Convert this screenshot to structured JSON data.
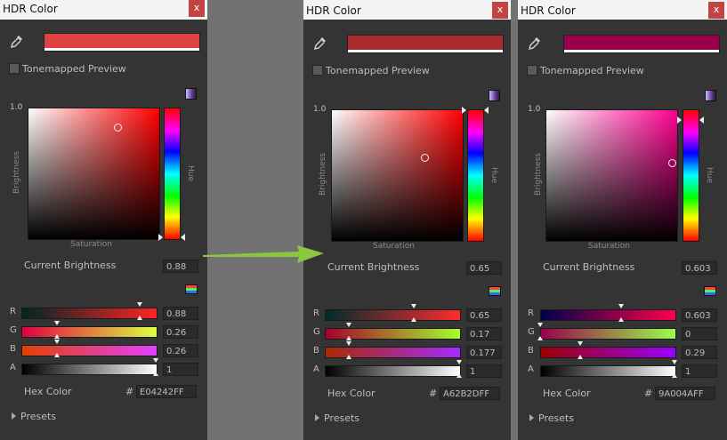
{
  "panels": [
    {
      "title": "HDR Color",
      "close": "x",
      "swatch_color": "#e04242",
      "tonemapped_label": "Tonemapped Preview",
      "one_label": "1.0",
      "brightness_axis": "Brightness",
      "hue_axis": "Hue",
      "saturation_axis": "Saturation",
      "hue_color": "#ff0000",
      "current_brightness_label": "Current Brightness",
      "current_brightness": "0.88",
      "channels": [
        {
          "label": "R",
          "value": "0.88",
          "grad_start": "#002424",
          "grad_end": "#ff2424"
        },
        {
          "label": "G",
          "value": "0.26",
          "grad_start": "#e00042",
          "grad_end": "#e0ff42"
        },
        {
          "label": "B",
          "value": "0.26",
          "grad_start": "#e04200",
          "grad_end": "#e042ff"
        },
        {
          "label": "A",
          "value": "1",
          "grad_start": "#000000",
          "grad_end": "#ffffff"
        }
      ],
      "hex_label": "Hex Color",
      "hash": "#",
      "hex_value": "E04242FF",
      "presets_label": "Presets"
    },
    {
      "title": "HDR Color",
      "close": "x",
      "swatch_color": "#a62b2d",
      "tonemapped_label": "Tonemapped Preview",
      "one_label": "1.0",
      "brightness_axis": "Brightness",
      "hue_axis": "Hue",
      "saturation_axis": "Saturation",
      "hue_color": "#ff0000",
      "current_brightness_label": "Current Brightness",
      "current_brightness": "0.65",
      "channels": [
        {
          "label": "R",
          "value": "0.65",
          "grad_start": "#002b2d",
          "grad_end": "#ff2b2d"
        },
        {
          "label": "G",
          "value": "0.17",
          "grad_start": "#a6002d",
          "grad_end": "#a6ff2d"
        },
        {
          "label": "B",
          "value": "0.177",
          "grad_start": "#a62b00",
          "grad_end": "#a62bff"
        },
        {
          "label": "A",
          "value": "1",
          "grad_start": "#000000",
          "grad_end": "#ffffff"
        }
      ],
      "hex_label": "Hex Color",
      "hash": "#",
      "hex_value": "A62B2DFF",
      "presets_label": "Presets"
    },
    {
      "title": "HDR Color",
      "close": "x",
      "swatch_color": "#9a004a",
      "tonemapped_label": "Tonemapped Preview",
      "one_label": "1.0",
      "brightness_axis": "Brightness",
      "hue_axis": "Hue",
      "saturation_axis": "Saturation",
      "hue_color": "#ff0090",
      "current_brightness_label": "Current Brightness",
      "current_brightness": "0.603",
      "channels": [
        {
          "label": "R",
          "value": "0.603",
          "grad_start": "#00004a",
          "grad_end": "#ff004a"
        },
        {
          "label": "G",
          "value": "0",
          "grad_start": "#9a004a",
          "grad_end": "#9aff4a"
        },
        {
          "label": "B",
          "value": "0.29",
          "grad_start": "#9a0000",
          "grad_end": "#9a00ff"
        },
        {
          "label": "A",
          "value": "1",
          "grad_start": "#000000",
          "grad_end": "#ffffff"
        }
      ],
      "hex_label": "Hex Color",
      "hash": "#",
      "hex_value": "9A004AFF",
      "presets_label": "Presets"
    }
  ],
  "transition_arrow_color": "#8cc63f"
}
